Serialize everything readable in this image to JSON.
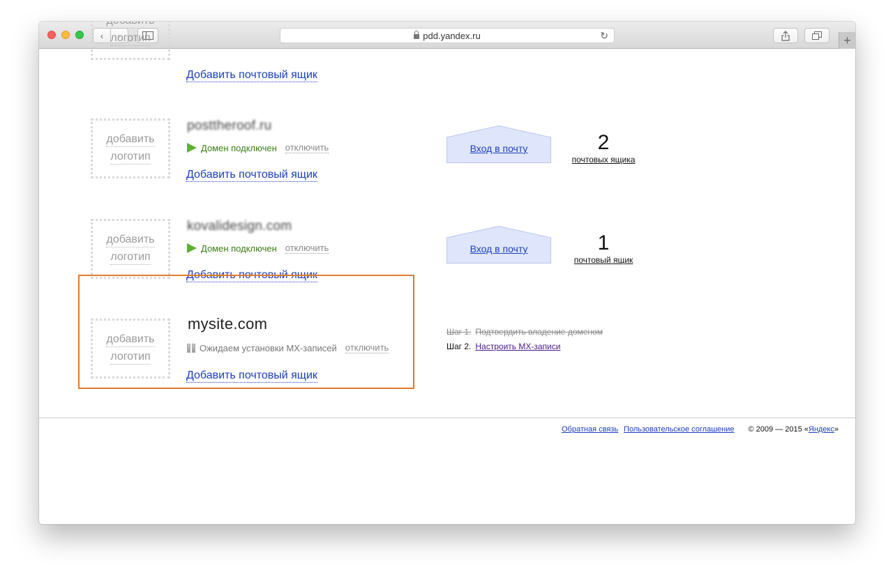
{
  "browser": {
    "url": "pdd.yandex.ru"
  },
  "logo_placeholder": {
    "line1": "добавить",
    "line2": "логотип"
  },
  "top_partial": {
    "add_mailbox": "Добавить почтовый ящик"
  },
  "domains": [
    {
      "name": "posttheroof.ru",
      "status": "Домен подключен",
      "disable": "отключить",
      "add_mailbox": "Добавить почтовый ящик",
      "mail_button": "Вход в почту",
      "mailbox_count": "2",
      "mailbox_label": "почтовых ящика"
    },
    {
      "name": "kovalidesign.com",
      "status": "Домен подключен",
      "disable": "отключить",
      "add_mailbox": "Добавить почтовый ящик",
      "mail_button": "Вход в почту",
      "mailbox_count": "1",
      "mailbox_label": "почтовый ящик"
    },
    {
      "name": "mysite.com",
      "status": "Ожидаем установки MX-записей",
      "disable": "отключить",
      "add_mailbox": "Добавить почтовый ящик"
    }
  ],
  "steps": {
    "step1_label": "Шаг 1.",
    "step1_text": "Подтвердить владение доменом",
    "step2_label": "Шаг 2.",
    "step2_link": "Настроить MX-записи"
  },
  "footer": {
    "feedback": "Обратная связь",
    "agreement": "Пользовательское соглашение",
    "copyright_prefix": "© 2009 — 2015 «",
    "yandex": "Яндекс",
    "copyright_suffix": "»"
  },
  "colors": {
    "link": "#1a3dc1",
    "ok_status": "#3b7d17",
    "highlight_border": "#e07a2f",
    "mail_button_fill": "#dfe6fb"
  }
}
